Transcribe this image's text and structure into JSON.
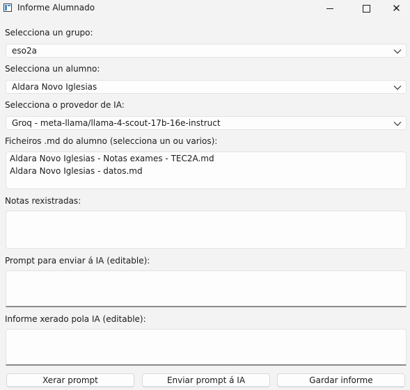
{
  "window": {
    "title": "Informe Alumnado",
    "icon": "app-window-icon"
  },
  "group": {
    "label": "Selecciona un grupo:",
    "value": "eso2a"
  },
  "student": {
    "label": "Selecciona un alumno:",
    "value": "Aldara Novo Iglesias"
  },
  "provider": {
    "label": "Selecciona o provedor de IA:",
    "value": "Groq - meta-llama/llama-4-scout-17b-16e-instruct"
  },
  "files": {
    "label": "Ficheiros .md do alumno (selecciona un ou varios):",
    "items": [
      "Aldara Novo Iglesias - Notas exames - TEC2A.md",
      "Aldara Novo Iglesias - datos.md"
    ]
  },
  "grades": {
    "label": "Notas rexistradas:",
    "value": ""
  },
  "prompt": {
    "label": "Prompt para enviar á IA (editable):",
    "value": ""
  },
  "report": {
    "label": "Informe xerado pola IA (editable):",
    "value": ""
  },
  "buttons": {
    "generate": "Xerar prompt",
    "send": "Enviar prompt á IA",
    "save": "Gardar informe"
  }
}
